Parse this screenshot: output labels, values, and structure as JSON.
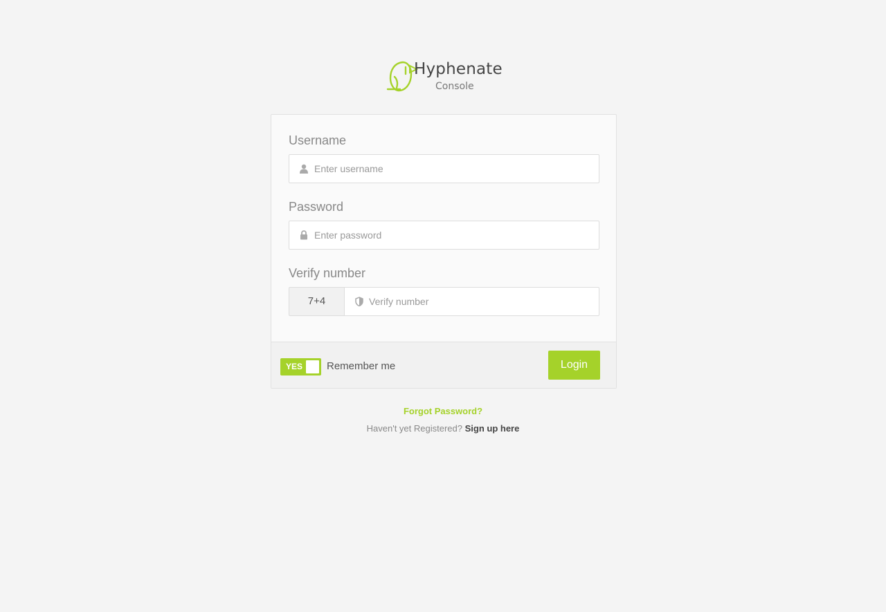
{
  "logo": {
    "brand": "Hyphenate",
    "sub": "Console",
    "color": "#a5d22a"
  },
  "form": {
    "username": {
      "label": "Username",
      "placeholder": "Enter username",
      "icon": "user-icon"
    },
    "password": {
      "label": "Password",
      "placeholder": "Enter password",
      "icon": "lock-icon"
    },
    "verify": {
      "label": "Verify number",
      "code": "7+4",
      "placeholder": "Verify number",
      "icon": "shield-icon"
    }
  },
  "footer": {
    "toggle_label": "YES",
    "toggle_on": true,
    "remember_label": "Remember me",
    "login_label": "Login"
  },
  "links": {
    "forgot": "Forgot Password?",
    "register_prompt": "Haven't yet Registered?",
    "signup": "Sign up here"
  },
  "colors": {
    "accent": "#a5d22a",
    "background": "#f4f4f4"
  }
}
